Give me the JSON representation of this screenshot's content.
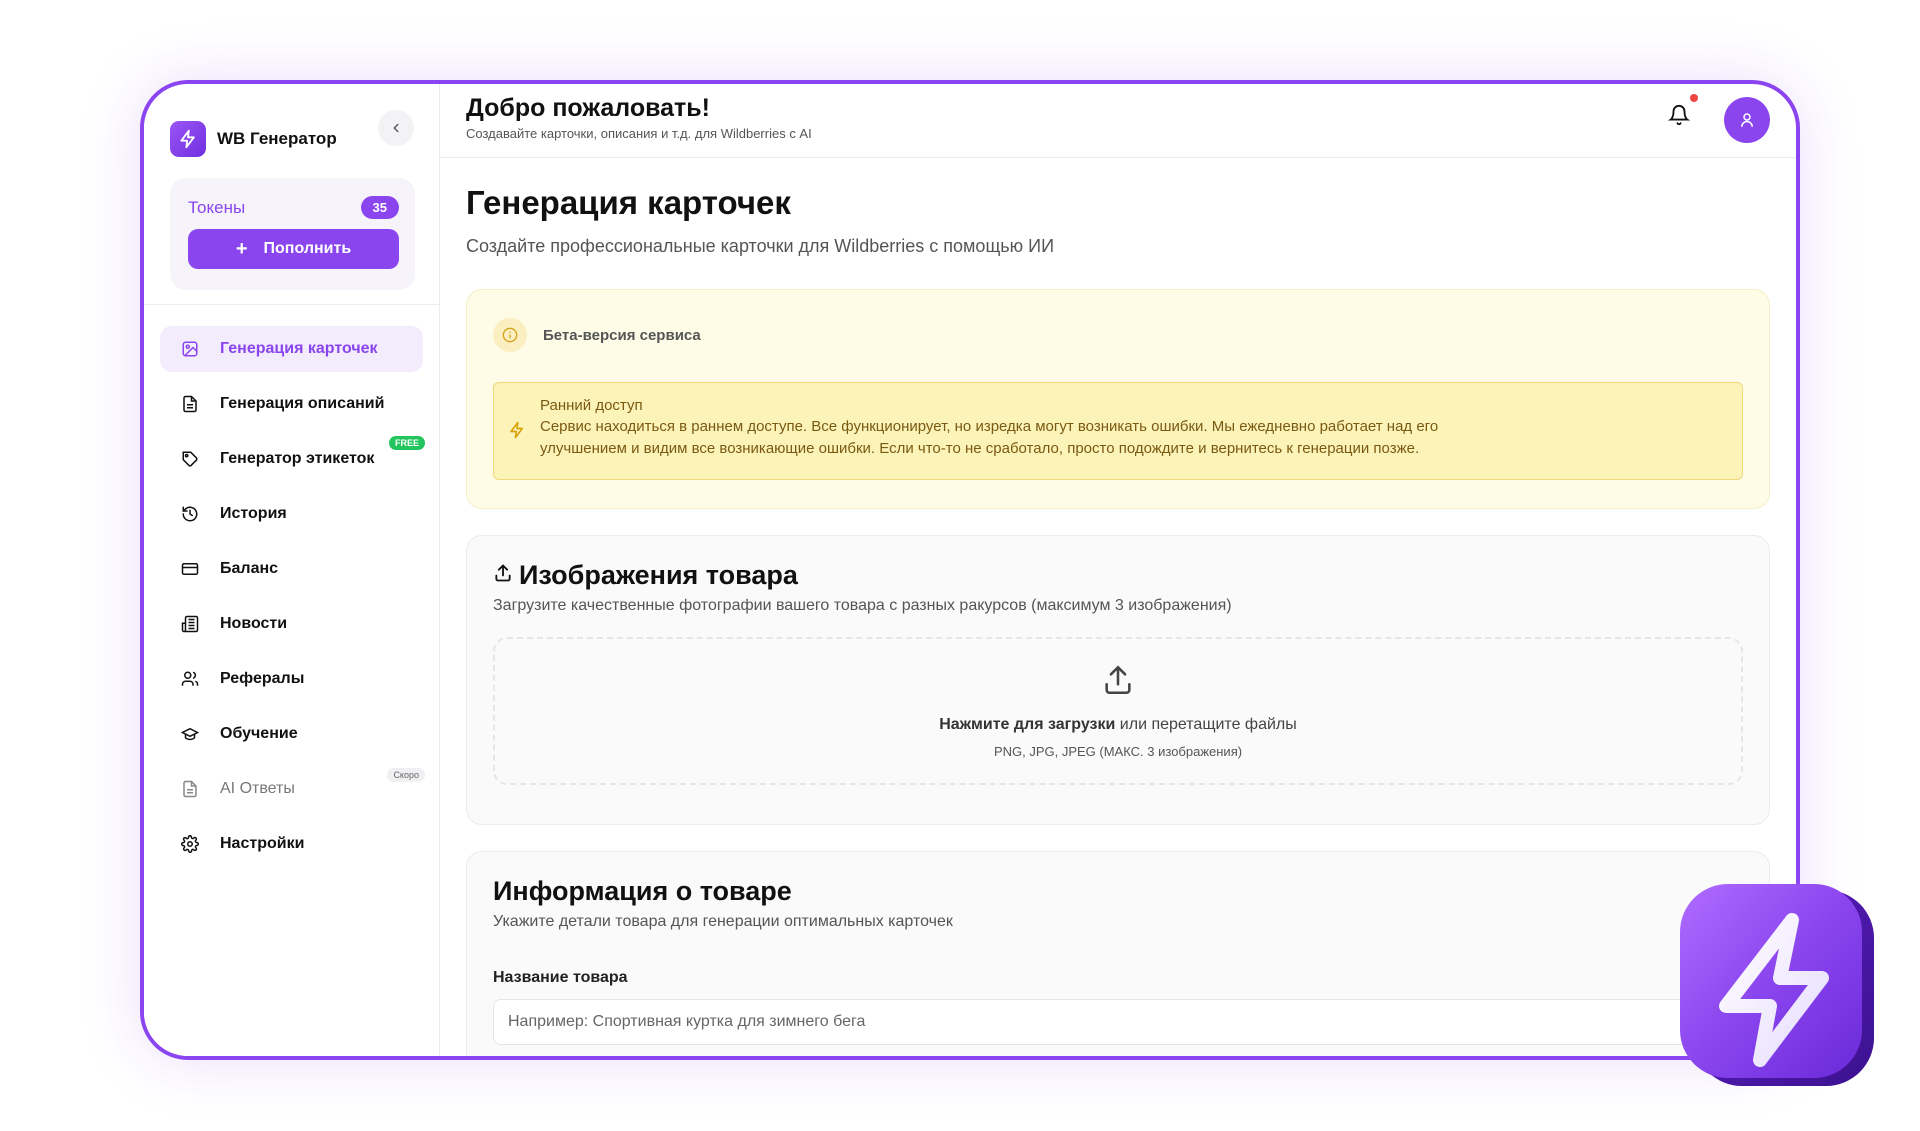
{
  "app": {
    "name": "WB Генератор"
  },
  "tokens": {
    "label": "Токены",
    "count": "35",
    "topup_label": "Пополнить"
  },
  "nav": [
    {
      "label": "Генерация карточек",
      "icon": "image-icon",
      "active": true
    },
    {
      "label": "Генерация описаний",
      "icon": "document-icon"
    },
    {
      "label": "Генератор этикеток",
      "icon": "tag-icon",
      "badge": "FREE"
    },
    {
      "label": "История",
      "icon": "history-icon"
    },
    {
      "label": "Баланс",
      "icon": "card-icon"
    },
    {
      "label": "Новости",
      "icon": "newspaper-icon"
    },
    {
      "label": "Рефералы",
      "icon": "users-icon"
    },
    {
      "label": "Обучение",
      "icon": "graduation-cap-icon"
    },
    {
      "label": "AI Ответы",
      "icon": "document-icon",
      "badge": "Скоро",
      "disabled": true
    },
    {
      "label": "Настройки",
      "icon": "gear-icon"
    }
  ],
  "header": {
    "title": "Добро пожаловать!",
    "subtitle": "Создавайте карточки, описания и т.д. для Wildberries с AI"
  },
  "page": {
    "title": "Генерация карточек",
    "subtitle": "Создайте профессиональные карточки для Wildberries с помощью ИИ"
  },
  "beta": {
    "label": "Бета-версия сервиса",
    "notice_title": "Ранний доступ",
    "notice_text_line1": "Сервис находиться в раннем доступе. Все функционирует, но изредка могут возникать ошибки. Мы ежедневно работает над его",
    "notice_text_line2": "улучшением и видим все возникающие ошибки. Если что-то не сработало, просто подождите и вернитесь к генерации позже."
  },
  "images_section": {
    "title": "Изображения товара",
    "subtitle": "Загрузите качественные фотографии вашего товара с разных ракурсов (максимум 3 изображения)",
    "upload_bold": "Нажмите для загрузки",
    "upload_rest": " или перетащите файлы",
    "formats": "PNG, JPG, JPEG (МАКС. 3 изображения)"
  },
  "info_section": {
    "title": "Информация о товаре",
    "subtitle": "Укажите детали товара для генерации оптимальных карточек",
    "name_label": "Название товара",
    "name_placeholder": "Например: Спортивная куртка для зимнего бега"
  },
  "colors": {
    "accent": "#8a45ee",
    "notice_bg": "#fcf3b8",
    "free_badge": "#22c55e",
    "notification_dot": "#ef4444"
  }
}
